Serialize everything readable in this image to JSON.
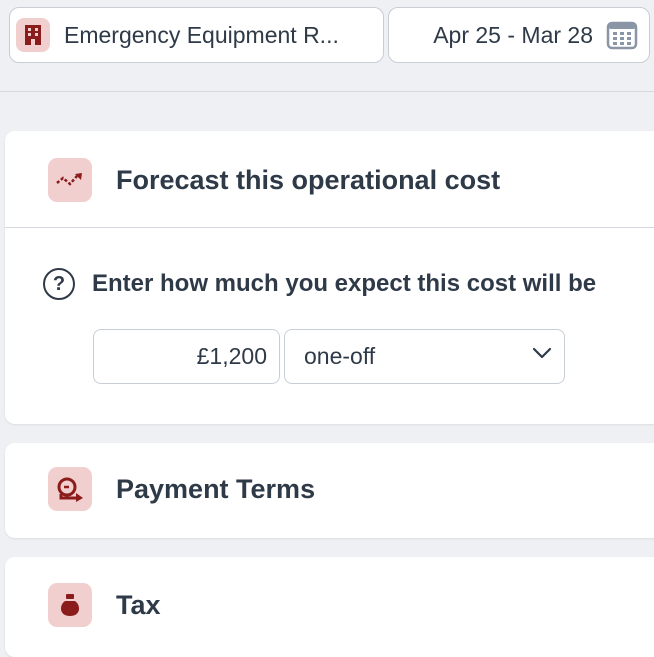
{
  "header": {
    "department": {
      "label": "Emergency Equipment R...",
      "icon": "building-icon"
    },
    "date_range": {
      "label": "Apr 25 - Mar 28",
      "icon": "calendar-icon"
    }
  },
  "forecast": {
    "title": "Forecast this operational cost",
    "icon": "trend-up-icon",
    "help_text": "Enter how much you expect this cost will be",
    "amount": "£1,200",
    "frequency": "one-off"
  },
  "payment_terms": {
    "title": "Payment Terms",
    "icon": "payment-terms-icon"
  },
  "tax": {
    "title": "Tax",
    "icon": "money-bag-icon"
  },
  "colors": {
    "accent": "#8b1c1c",
    "icon_bg": "#f2cfcf",
    "text": "#2f3a48",
    "page_bg": "#eef0f3"
  }
}
